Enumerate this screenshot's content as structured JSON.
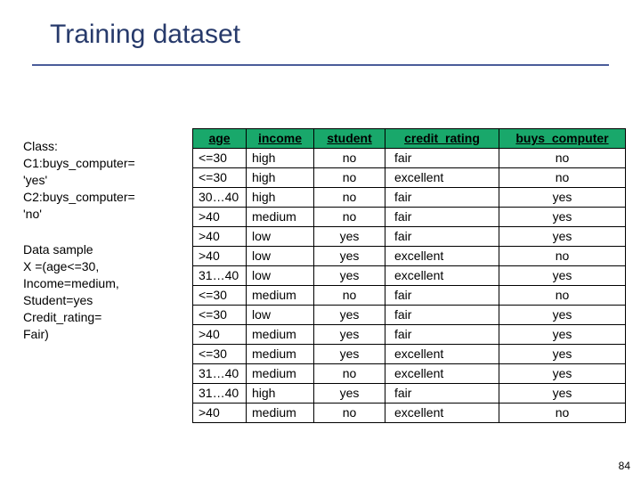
{
  "title": "Training dataset",
  "side": {
    "class_label": "Class:",
    "c1_line1": "C1:buys_computer=",
    "c1_line2": "'yes'",
    "c2_line1": "C2:buys_computer=",
    "c2_line2": "'no'",
    "sample_heading": "Data sample",
    "sample_l1": "X =(age<=30,",
    "sample_l2": "Income=medium,",
    "sample_l3": "Student=yes",
    "sample_l4": "Credit_rating=",
    "sample_l5": "Fair)"
  },
  "table": {
    "headers": [
      "age",
      "income",
      "student",
      "credit_rating",
      "buys_computer"
    ],
    "rows": [
      [
        "<=30",
        "high",
        "no",
        "fair",
        "no"
      ],
      [
        "<=30",
        "high",
        "no",
        "excellent",
        "no"
      ],
      [
        "30…40",
        "high",
        "no",
        "fair",
        "yes"
      ],
      [
        ">40",
        "medium",
        "no",
        "fair",
        "yes"
      ],
      [
        ">40",
        "low",
        "yes",
        "fair",
        "yes"
      ],
      [
        ">40",
        "low",
        "yes",
        "excellent",
        "no"
      ],
      [
        "31…40",
        "low",
        "yes",
        "excellent",
        "yes"
      ],
      [
        "<=30",
        "medium",
        "no",
        "fair",
        "no"
      ],
      [
        "<=30",
        "low",
        "yes",
        "fair",
        "yes"
      ],
      [
        ">40",
        "medium",
        "yes",
        "fair",
        "yes"
      ],
      [
        "<=30",
        "medium",
        "yes",
        "excellent",
        "yes"
      ],
      [
        "31…40",
        "medium",
        "no",
        "excellent",
        "yes"
      ],
      [
        "31…40",
        "high",
        "yes",
        "fair",
        "yes"
      ],
      [
        ">40",
        "medium",
        "no",
        "excellent",
        "no"
      ]
    ]
  },
  "page_number": "84",
  "chart_data": {
    "type": "table",
    "title": "Training dataset",
    "columns": [
      "age",
      "income",
      "student",
      "credit_rating",
      "buys_computer"
    ],
    "rows": [
      {
        "age": "<=30",
        "income": "high",
        "student": "no",
        "credit_rating": "fair",
        "buys_computer": "no"
      },
      {
        "age": "<=30",
        "income": "high",
        "student": "no",
        "credit_rating": "excellent",
        "buys_computer": "no"
      },
      {
        "age": "30…40",
        "income": "high",
        "student": "no",
        "credit_rating": "fair",
        "buys_computer": "yes"
      },
      {
        "age": ">40",
        "income": "medium",
        "student": "no",
        "credit_rating": "fair",
        "buys_computer": "yes"
      },
      {
        "age": ">40",
        "income": "low",
        "student": "yes",
        "credit_rating": "fair",
        "buys_computer": "yes"
      },
      {
        "age": ">40",
        "income": "low",
        "student": "yes",
        "credit_rating": "excellent",
        "buys_computer": "no"
      },
      {
        "age": "31…40",
        "income": "low",
        "student": "yes",
        "credit_rating": "excellent",
        "buys_computer": "yes"
      },
      {
        "age": "<=30",
        "income": "medium",
        "student": "no",
        "credit_rating": "fair",
        "buys_computer": "no"
      },
      {
        "age": "<=30",
        "income": "low",
        "student": "yes",
        "credit_rating": "fair",
        "buys_computer": "yes"
      },
      {
        "age": ">40",
        "income": "medium",
        "student": "yes",
        "credit_rating": "fair",
        "buys_computer": "yes"
      },
      {
        "age": "<=30",
        "income": "medium",
        "student": "yes",
        "credit_rating": "excellent",
        "buys_computer": "yes"
      },
      {
        "age": "31…40",
        "income": "medium",
        "student": "no",
        "credit_rating": "excellent",
        "buys_computer": "yes"
      },
      {
        "age": "31…40",
        "income": "high",
        "student": "yes",
        "credit_rating": "fair",
        "buys_computer": "yes"
      },
      {
        "age": ">40",
        "income": "medium",
        "student": "no",
        "credit_rating": "excellent",
        "buys_computer": "no"
      }
    ]
  }
}
